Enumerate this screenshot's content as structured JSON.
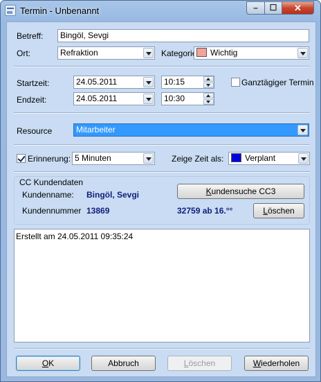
{
  "window": {
    "title": "Termin - Unbenannt",
    "min_glyph": "–",
    "max_glyph": "☐",
    "close_glyph": "✕"
  },
  "betreff": {
    "label": "Betreff:",
    "value": "Bingöl, Sevgi"
  },
  "ort": {
    "label": "Ort:",
    "value": "Refraktion"
  },
  "kategorie": {
    "label": "Kategorie",
    "value": "Wichtig",
    "color": "#f4a39a"
  },
  "startzeit": {
    "label": "Startzeit:",
    "date": "24.05.2011",
    "time": "10:15"
  },
  "endzeit": {
    "label": "Endzeit:",
    "date": "24.05.2011",
    "time": "10:30"
  },
  "ganztaegig": {
    "label": "Ganztägiger Termin",
    "checked": false
  },
  "resource": {
    "label": "Resource",
    "value": "Mitarbeiter"
  },
  "erinnerung": {
    "label": "Erinnerung:",
    "checked": true,
    "value": "5 Minuten"
  },
  "zeige_zeit": {
    "label": "Zeige Zeit als:",
    "value": "Verplant",
    "color": "#0000dd"
  },
  "kunden": {
    "group_title": "CC Kundendaten",
    "name_label": "Kundenname:",
    "name_value": "Bingöl, Sevgi",
    "nummer_label": "Kundennummer",
    "nummer_value": "13869",
    "search_button_underlined": "K",
    "search_button_rest": "undensuche CC3",
    "info": "32759 ab 16.°°",
    "loeschen_button_underlined": "L",
    "loeschen_button_rest": "öschen"
  },
  "memo": {
    "text": "Erstellt am 24.05.2011 09:35:24"
  },
  "footer": {
    "ok_underlined": "O",
    "ok_rest": "K",
    "abbruch": "Abbruch",
    "loeschen_underlined": "L",
    "loeschen_rest": "öschen",
    "wiederholen_underlined": "W",
    "wiederholen_rest": "iederholen"
  },
  "colors": {
    "accent": "#3399ff",
    "panel": "#c9dcf3",
    "customer_text": "#0f1e7a"
  }
}
